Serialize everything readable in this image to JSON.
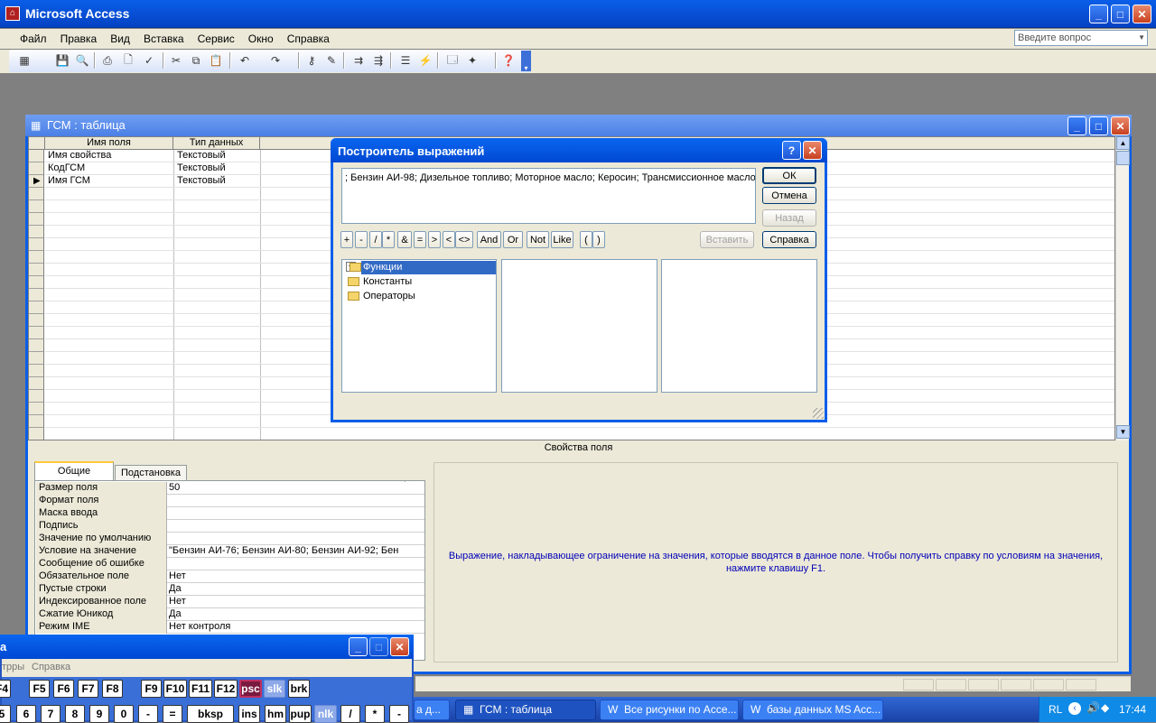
{
  "app": {
    "title": "Microsoft Access",
    "menu": [
      "Файл",
      "Правка",
      "Вид",
      "Вставка",
      "Сервис",
      "Окно",
      "Справка"
    ],
    "help_placeholder": "Введите вопрос"
  },
  "table_window": {
    "title": "ГСМ : таблица",
    "columns": [
      "Имя поля",
      "Тип данных"
    ],
    "rows": [
      {
        "name": "Имя свойства",
        "type": "Текстовый"
      },
      {
        "name": "КодГСМ",
        "type": "Текстовый"
      },
      {
        "name": "Имя ГСМ",
        "type": "Текстовый",
        "current": true
      }
    ],
    "field_props_header": "Свойства поля",
    "tabs": [
      "Общие",
      "Подстановка"
    ],
    "properties": [
      {
        "label": "Размер поля",
        "value": "50"
      },
      {
        "label": "Формат поля",
        "value": ""
      },
      {
        "label": "Маска ввода",
        "value": ""
      },
      {
        "label": "Подпись",
        "value": ""
      },
      {
        "label": "Значение по умолчанию",
        "value": ""
      },
      {
        "label": "Условие на значение",
        "value": "\"Бензин АИ-76; Бензин АИ-80; Бензин АИ-92; Бен"
      },
      {
        "label": "Сообщение об ошибке",
        "value": ""
      },
      {
        "label": "Обязательное поле",
        "value": "Нет"
      },
      {
        "label": "Пустые строки",
        "value": "Да"
      },
      {
        "label": "Индексированное поле",
        "value": "Нет"
      },
      {
        "label": "Сжатие Юникод",
        "value": "Да"
      },
      {
        "label": "Режим IME",
        "value": "Нет контроля"
      }
    ],
    "help_text": "Выражение, накладывающее ограничение на значения, которые вводятся в данное поле.  Чтобы получить справку по условиям на значения, нажмите клавишу F1."
  },
  "dialog": {
    "title": "Построитель выражений",
    "expression": "; Бензин АИ-98; Дизельное топливо; Моторное масло; Керосин; Трансмиссионное масло\"",
    "buttons": {
      "ok": "ОК",
      "cancel": "Отмена",
      "back": "Назад",
      "paste": "Вставить",
      "help": "Справка"
    },
    "operators": [
      "+",
      "-",
      "/",
      "*",
      "&",
      "=",
      ">",
      "<",
      "<>",
      "And",
      "Or",
      "Not",
      "Like",
      "(",
      ")"
    ],
    "tree": [
      "Функции",
      "Константы",
      "Операторы"
    ]
  },
  "osk": {
    "title_frag": "а",
    "menu_frag": [
      "трры",
      "Справка"
    ],
    "row1": [
      "F4",
      "F5",
      "F6",
      "F7",
      "F8",
      "F9",
      "F10",
      "F11",
      "F12",
      "psc",
      "slk",
      "brk"
    ],
    "row2": [
      "5",
      "6",
      "7",
      "8",
      "9",
      "0",
      "-",
      "=",
      "bksp",
      "ins",
      "hm",
      "pup",
      "nlk",
      "/",
      "*",
      "-"
    ]
  },
  "taskbar": {
    "items": [
      "а д...",
      "ГСМ : таблица",
      "Все рисунки по Acce...",
      "базы данных MS Acc..."
    ],
    "lang": "RL",
    "time": "17:44"
  }
}
